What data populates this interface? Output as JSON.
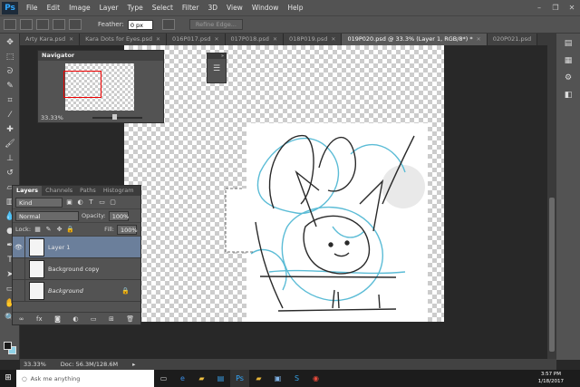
{
  "app": {
    "logo": "Ps",
    "name": "Adobe Photoshop"
  },
  "menu": [
    "File",
    "Edit",
    "Image",
    "Layer",
    "Type",
    "Select",
    "Filter",
    "3D",
    "View",
    "Window",
    "Help"
  ],
  "options": {
    "feather_label": "Feather:",
    "feather_value": "0 px",
    "refine_edge": "Refine Edge..."
  },
  "tabs": [
    {
      "label": "Arty Kara.psd",
      "active": false
    },
    {
      "label": "Kara Dots for Eyes.psd",
      "active": false
    },
    {
      "label": "016P017.psd",
      "active": false
    },
    {
      "label": "017P018.psd",
      "active": false
    },
    {
      "label": "018P019.psd",
      "active": false
    },
    {
      "label": "019P020.psd @ 33.3% (Layer 1, RGB/8*) *",
      "active": true
    },
    {
      "label": "020P021.psd",
      "active": false
    }
  ],
  "navigator": {
    "title": "Navigator",
    "zoom": "33.33%"
  },
  "layers_panel": {
    "tabs": [
      "Layers",
      "Channels",
      "Paths",
      "Histogram"
    ],
    "kind_label": "Kind",
    "blend_mode": "Normal",
    "opacity_label": "Opacity:",
    "opacity_value": "100%",
    "lock_label": "Lock:",
    "fill_label": "Fill:",
    "fill_value": "100%",
    "layers": [
      {
        "name": "Layer 1",
        "visible": true,
        "selected": true,
        "locked": false
      },
      {
        "name": "Background copy",
        "visible": false,
        "selected": false,
        "locked": false
      },
      {
        "name": "Background",
        "visible": false,
        "selected": false,
        "locked": true
      }
    ]
  },
  "status": {
    "zoom": "33.33%",
    "doc": "Doc: 56.3M/128.6M"
  },
  "taskbar": {
    "search_placeholder": "Ask me anything",
    "time": "3:57 PM",
    "date": "1/18/2017"
  },
  "colors": {
    "foreground": "#1a1a1a",
    "background": "#8fd1e6",
    "accent": "#31a8ff"
  }
}
